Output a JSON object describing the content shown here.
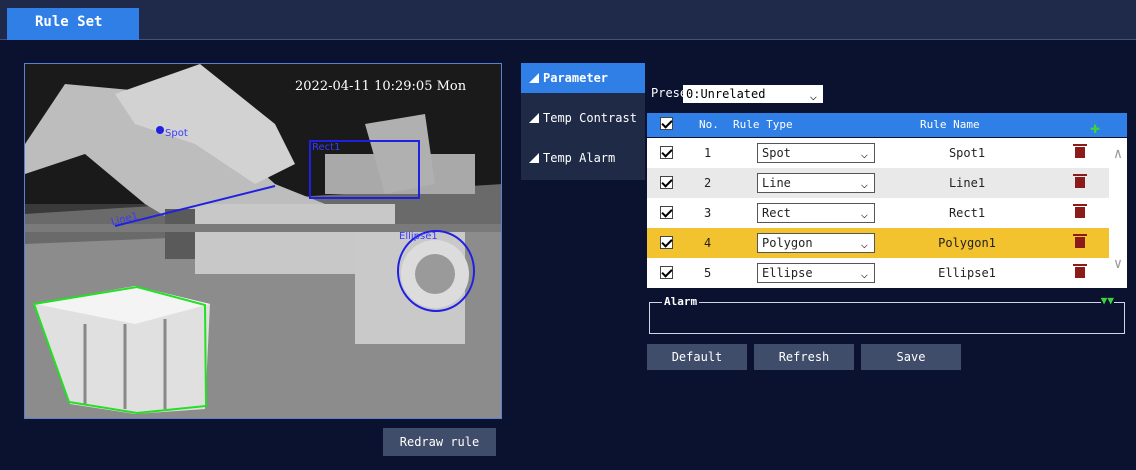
{
  "header": {
    "active_tab": "Rule Set"
  },
  "camera": {
    "timestamp": "2022-04-11 10:29:05 Mon",
    "rule_labels": {
      "spot": "Spot",
      "rect": "Rect1",
      "line": "Line1",
      "ellipse": "Ellipse1"
    },
    "redraw_label": "Redraw rule"
  },
  "side_tabs": [
    {
      "label": "Parameter",
      "active": true
    },
    {
      "label": "Temp Contrast",
      "active": false
    },
    {
      "label": "Temp Alarm",
      "active": false
    }
  ],
  "preset": {
    "label": "Preset",
    "value": "0:Unrelated"
  },
  "table": {
    "columns": {
      "no": "No.",
      "type": "Rule Type",
      "name": "Rule Name"
    },
    "rows": [
      {
        "no": "1",
        "type": "Spot",
        "name": "Spot1",
        "checked": true
      },
      {
        "no": "2",
        "type": "Line",
        "name": "Line1",
        "checked": true
      },
      {
        "no": "3",
        "type": "Rect",
        "name": "Rect1",
        "checked": true
      },
      {
        "no": "4",
        "type": "Polygon",
        "name": "Polygon1",
        "checked": true,
        "selected": true
      },
      {
        "no": "5",
        "type": "Ellipse",
        "name": "Ellipse1",
        "checked": true
      }
    ]
  },
  "alarm": {
    "label": "Alarm"
  },
  "buttons": {
    "default": "Default",
    "refresh": "Refresh",
    "save": "Save"
  },
  "colors": {
    "accent": "#2f7fe6",
    "selected_row": "#f3c22f",
    "rule_blue": "#2020e0",
    "polygon_green": "#22e022"
  }
}
